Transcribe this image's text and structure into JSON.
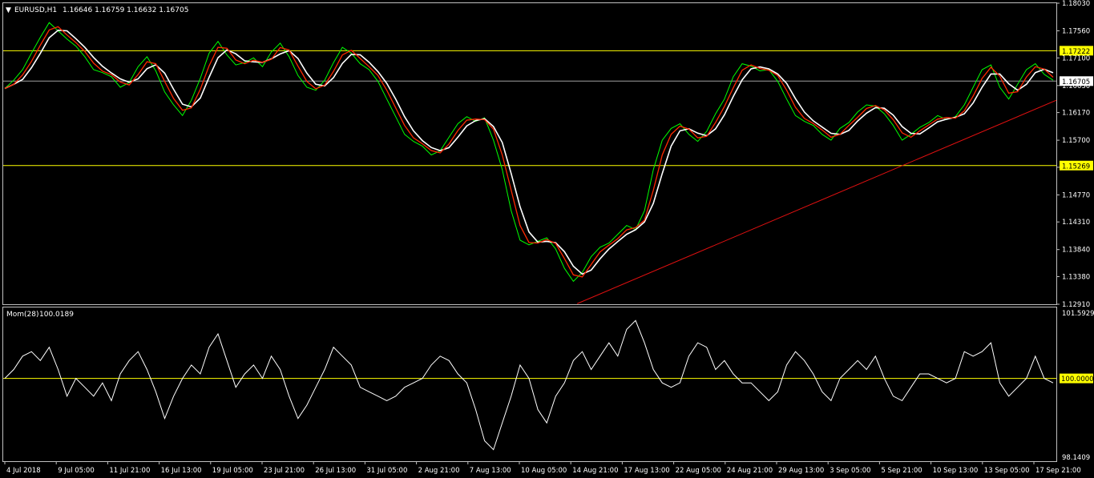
{
  "header": {
    "symbol": "EURUSD,H1",
    "ohlc": "1.16646 1.16759 1.16632 1.16705",
    "collapse_glyph": "▼"
  },
  "indicator_header": {
    "name": "Mom(28)",
    "value": "100.0189"
  },
  "colors": {
    "background": "#000000",
    "price_line": "#00ff00",
    "ma_fast": "#ff2a00",
    "ma_slow": "#ffffff",
    "momentum": "#ffffff",
    "level_line": "#ffff00",
    "current_price_line": "#a0a0a0",
    "trend_line": "#e01010",
    "grid_border": "#c0c0c0"
  },
  "chart_data": [
    {
      "type": "line",
      "title": "EURUSD,H1",
      "ylim": [
        1.1291,
        1.1803
      ],
      "y_ticks": [
        "1.18030",
        "1.17560",
        "1.17100",
        "1.16630",
        "1.16170",
        "1.15700",
        "1.15240",
        "1.14770",
        "1.14310",
        "1.13840",
        "1.13380",
        "1.12910"
      ],
      "x_ticks": [
        "4 Jul 2018",
        "9 Jul 05:00",
        "11 Jul 21:00",
        "16 Jul 13:00",
        "19 Jul 05:00",
        "23 Jul 21:00",
        "26 Jul 13:00",
        "31 Jul 05:00",
        "2 Aug 21:00",
        "7 Aug 13:00",
        "10 Aug 05:00",
        "14 Aug 21:00",
        "17 Aug 13:00",
        "22 Aug 05:00",
        "24 Aug 21:00",
        "29 Aug 13:00",
        "3 Sep 05:00",
        "5 Sep 21:00",
        "10 Sep 13:00",
        "13 Sep 05:00",
        "17 Sep 21:00"
      ],
      "horizontal_levels": [
        {
          "label": "1.17222",
          "value": 1.17222
        },
        {
          "label": "1.15269",
          "value": 1.15269
        }
      ],
      "current_price": {
        "label": "1.16705",
        "value": 1.16705
      },
      "trend_line": {
        "from": {
          "x": "14 Aug 2018",
          "y": 1.1292
        },
        "to": {
          "x": "18 Sep 2018",
          "y": 1.1638
        }
      },
      "series": [
        {
          "key": "price",
          "values": [
            1.1658,
            1.1672,
            1.169,
            1.1718,
            1.1745,
            1.177,
            1.1756,
            1.1742,
            1.173,
            1.1712,
            1.169,
            1.1685,
            1.1678,
            1.166,
            1.1668,
            1.1695,
            1.1712,
            1.1688,
            1.1652,
            1.163,
            1.1612,
            1.1638,
            1.1675,
            1.1718,
            1.1738,
            1.1715,
            1.1698,
            1.1702,
            1.171,
            1.1695,
            1.172,
            1.1735,
            1.1712,
            1.168,
            1.166,
            1.1655,
            1.1672,
            1.1702,
            1.1728,
            1.1718,
            1.17,
            1.169,
            1.167,
            1.164,
            1.161,
            1.158,
            1.1568,
            1.156,
            1.1545,
            1.1552,
            1.1575,
            1.1598,
            1.161,
            1.1602,
            1.1608,
            1.157,
            1.152,
            1.145,
            1.14,
            1.1392,
            1.1398,
            1.1404,
            1.1385,
            1.1352,
            1.133,
            1.1345,
            1.1372,
            1.1388,
            1.1395,
            1.141,
            1.1425,
            1.1418,
            1.145,
            1.152,
            1.157,
            1.159,
            1.1598,
            1.158,
            1.1568,
            1.1585,
            1.1615,
            1.164,
            1.1678,
            1.17,
            1.1696,
            1.1688,
            1.169,
            1.167,
            1.164,
            1.1612,
            1.1602,
            1.1595,
            1.158,
            1.157,
            1.159,
            1.16,
            1.1618,
            1.163,
            1.1628,
            1.1615,
            1.1595,
            1.157,
            1.158,
            1.1592,
            1.16,
            1.1612,
            1.1605,
            1.161,
            1.163,
            1.166,
            1.169,
            1.1698,
            1.166,
            1.164,
            1.1665,
            1.169,
            1.17,
            1.1682,
            1.1672
          ]
        },
        {
          "key": "momentum",
          "ylim": [
            98.1409,
            101.5929
          ],
          "y_ticks": [
            "101.5929",
            "98.1409"
          ],
          "level": {
            "label": "100.0000",
            "value": 100.0
          },
          "values": [
            100.0,
            100.2,
            100.5,
            100.6,
            100.4,
            100.7,
            100.2,
            99.6,
            100.0,
            99.8,
            99.6,
            99.9,
            99.5,
            100.1,
            100.4,
            100.6,
            100.2,
            99.7,
            99.1,
            99.6,
            100.0,
            100.3,
            100.1,
            100.7,
            101.0,
            100.4,
            99.8,
            100.1,
            100.3,
            100.0,
            100.5,
            100.2,
            99.6,
            99.1,
            99.4,
            99.8,
            100.2,
            100.7,
            100.5,
            100.3,
            99.8,
            99.7,
            99.6,
            99.5,
            99.6,
            99.8,
            99.9,
            100.0,
            100.3,
            100.5,
            100.4,
            100.1,
            99.9,
            99.3,
            98.6,
            98.4,
            99.0,
            99.6,
            100.3,
            100.0,
            99.3,
            99.0,
            99.6,
            99.9,
            100.4,
            100.6,
            100.2,
            100.5,
            100.8,
            100.5,
            101.1,
            101.3,
            100.8,
            100.2,
            99.9,
            99.8,
            99.9,
            100.5,
            100.8,
            100.7,
            100.2,
            100.4,
            100.1,
            99.9,
            99.9,
            99.7,
            99.5,
            99.7,
            100.3,
            100.6,
            100.4,
            100.1,
            99.7,
            99.5,
            100.0,
            100.2,
            100.4,
            100.2,
            100.5,
            100.0,
            99.6,
            99.5,
            99.8,
            100.1,
            100.1,
            100.0,
            99.9,
            100.0,
            100.6,
            100.5,
            100.6,
            100.8,
            99.9,
            99.6,
            99.8,
            100.0,
            100.5,
            100.0,
            99.9
          ]
        }
      ]
    }
  ]
}
